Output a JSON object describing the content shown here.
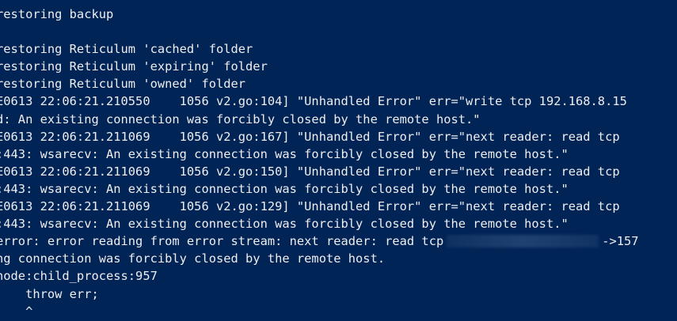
{
  "terminal": {
    "colors": {
      "background": "#012456",
      "foreground": "#eeedf0"
    },
    "lines": [
      "restoring backup",
      "",
      "restoring Reticulum 'cached' folder",
      "restoring Reticulum 'expiring' folder",
      "restoring Reticulum 'owned' folder",
      "E0613 22:06:21.210550    1056 v2.go:104] \"Unhandled Error\" err=\"write tcp 192.168.8.15",
      "d: An existing connection was forcibly closed by the remote host.\"",
      "E0613 22:06:21.211069    1056 v2.go:167] \"Unhandled Error\" err=\"next reader: read tcp",
      ":443: wsarecv: An existing connection was forcibly closed by the remote host.\"",
      "E0613 22:06:21.211069    1056 v2.go:150] \"Unhandled Error\" err=\"next reader: read tcp",
      ":443: wsarecv: An existing connection was forcibly closed by the remote host.\"",
      "E0613 22:06:21.211069    1056 v2.go:129] \"Unhandled Error\" err=\"next reader: read tcp",
      ":443: wsarecv: An existing connection was forcibly closed by the remote host.\"",
      {
        "before": "error: error reading from error stream: next reader: read tcp",
        "after": "->157"
      },
      "ng connection was forcibly closed by the remote host.",
      "node:child_process:957",
      "    throw err;",
      "    ^"
    ]
  }
}
